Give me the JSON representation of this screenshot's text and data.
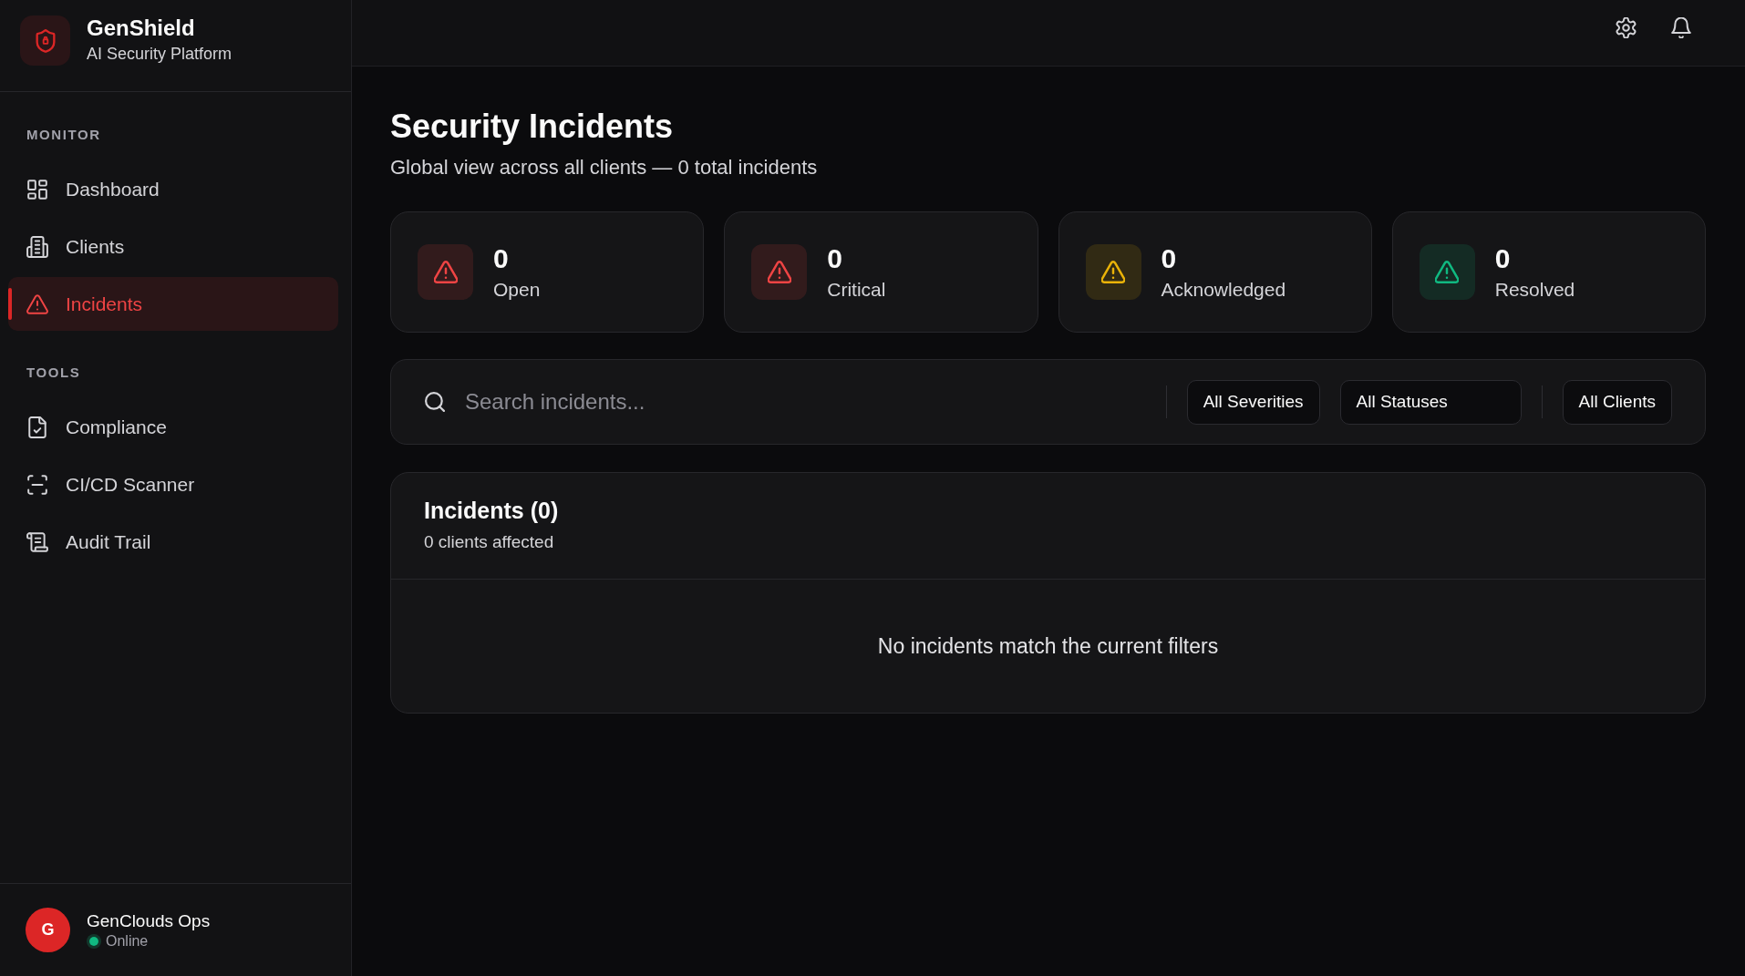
{
  "sidebar": {
    "brand": {
      "name": "GenShield",
      "tagline": "AI Security Platform"
    },
    "sections": [
      {
        "title": "MONITOR",
        "items": [
          {
            "label": "Dashboard",
            "selected": false
          },
          {
            "label": "Clients",
            "selected": false
          },
          {
            "label": "Incidents",
            "selected": true
          }
        ]
      },
      {
        "title": "TOOLS",
        "items": [
          {
            "label": "Compliance",
            "selected": false
          },
          {
            "label": "CI/CD Scanner",
            "selected": false
          },
          {
            "label": "Audit Trail",
            "selected": false
          }
        ]
      }
    ],
    "user": {
      "initial": "G",
      "name": "GenClouds Ops",
      "status": "Online",
      "online": true
    }
  },
  "page": {
    "title": "Security Incidents",
    "subtitle": "Global view across all clients — 0 total incidents"
  },
  "stats": [
    {
      "value": "0",
      "label": "Open",
      "color": "#ef4444"
    },
    {
      "value": "0",
      "label": "Critical",
      "color": "#ef4444"
    },
    {
      "value": "0",
      "label": "Acknowledged",
      "color": "#eab308"
    },
    {
      "value": "0",
      "label": "Resolved",
      "color": "#10b981"
    }
  ],
  "filters": {
    "search": {
      "placeholder": "Search incidents..."
    },
    "groups": [
      {
        "options": [
          "All Severities",
          "All Statuses"
        ]
      },
      {
        "options": [
          "All Clients"
        ]
      }
    ]
  },
  "incidents": {
    "title": "Incidents (0)",
    "subtitle": "0 clients affected",
    "empty_message": "No incidents match the current filters"
  }
}
